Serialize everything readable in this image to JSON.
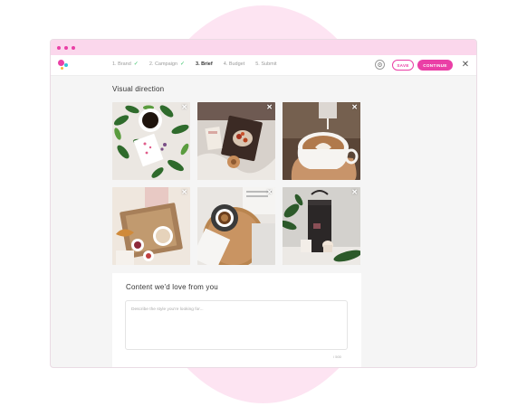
{
  "colors": {
    "accent": "#ea3fa6",
    "background_circle": "#fde4f2",
    "titlebar": "#fbd7ec",
    "success": "#3cc46b"
  },
  "window": {
    "dots": [
      "dot",
      "dot",
      "dot"
    ]
  },
  "topbar": {
    "logo_icon": "brand-logo-icon",
    "steps": [
      {
        "label": "1. Brand",
        "done": true
      },
      {
        "label": "2. Campaign",
        "done": true
      },
      {
        "label": "3. Brief",
        "active": true
      },
      {
        "label": "4. Budget"
      },
      {
        "label": "5. Submit"
      }
    ],
    "check_glyph": "✓",
    "settings_icon": "⚙",
    "save_label": "SAVE",
    "continue_label": "CONTINUE",
    "close_icon": "✕"
  },
  "visual_direction": {
    "title": "Visual direction",
    "remove_icon": "✕",
    "photos": [
      {
        "subject": "coffee cup with leaves and card"
      },
      {
        "subject": "breakfast tray on bed"
      },
      {
        "subject": "latte art being poured"
      },
      {
        "subject": "croissant breakfast tray"
      },
      {
        "subject": "espresso on wooden board"
      },
      {
        "subject": "dark coffee bag with plant"
      }
    ]
  },
  "content": {
    "title": "Content we'd love from you",
    "placeholder": "Describe the style you're looking for...",
    "counter": "/ 500"
  }
}
